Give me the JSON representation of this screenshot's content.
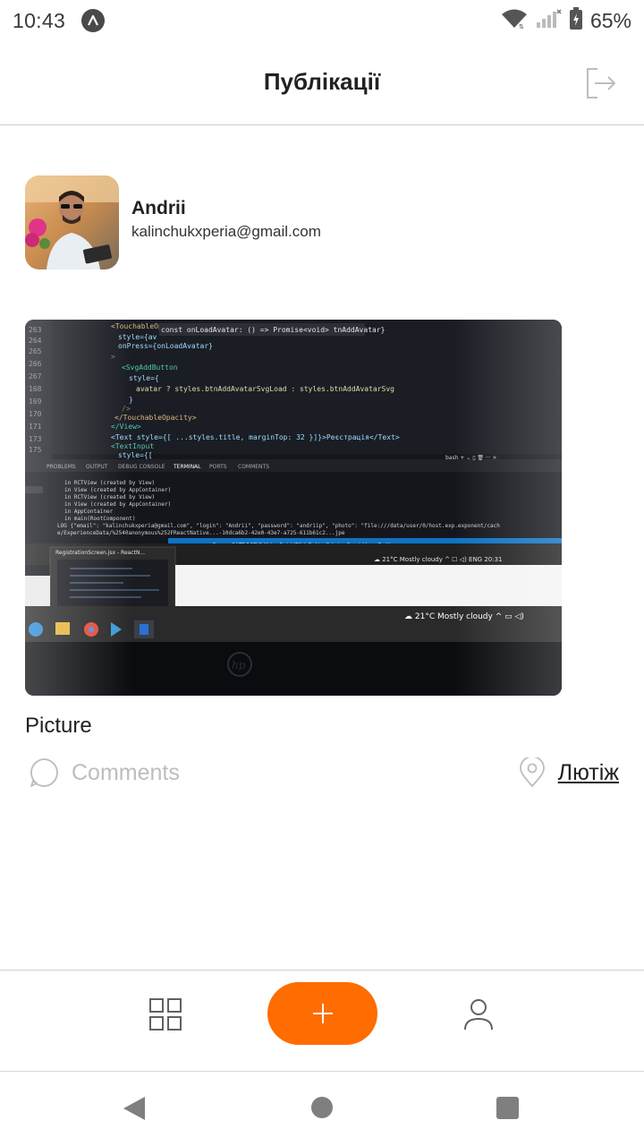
{
  "status_bar": {
    "time": "10:43",
    "app_icon": "app-notification-icon",
    "battery_percent": "65%",
    "icons": [
      "wifi-icon",
      "signal-icon",
      "battery-charging-icon"
    ]
  },
  "header": {
    "title": "Публікації",
    "logout_icon": "logout-icon"
  },
  "profile": {
    "name": "Andrii",
    "email": "kalinchukxperia@gmail.com"
  },
  "post": {
    "title": "Picture",
    "comments_label": "Comments",
    "location_label": "Лютіж"
  },
  "tabbar": {
    "icons": [
      "grid-icon",
      "plus-icon",
      "user-icon"
    ]
  },
  "colors": {
    "accent": "#FF6C00",
    "muted": "#BDBDBD",
    "text": "#212121",
    "divider": "#CFCFCF"
  }
}
